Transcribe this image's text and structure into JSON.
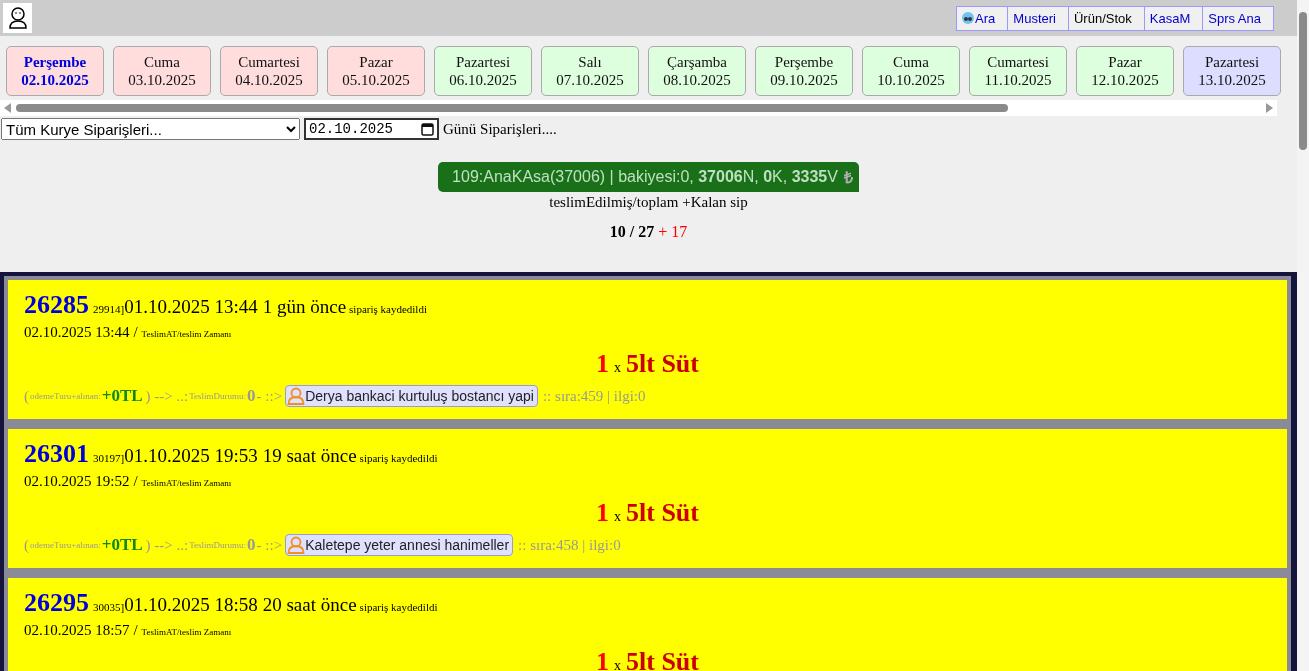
{
  "nav_links": [
    {
      "label": "Ara",
      "color": "#0000cc",
      "icon": true
    },
    {
      "label": "Musteri",
      "color": "#0000cc"
    },
    {
      "label": "Ürün/Stok",
      "color": "#000000"
    },
    {
      "label": "KasaM",
      "color": "#0000cc"
    },
    {
      "label": "Sprs Ana",
      "color": "#0000cc"
    }
  ],
  "days": [
    {
      "day": "Perşembe",
      "date": "02.10.2025",
      "selected": true,
      "color": "#ffdddd"
    },
    {
      "day": "Cuma",
      "date": "03.10.2025",
      "selected": false,
      "color": "#ffdddd"
    },
    {
      "day": "Cumartesi",
      "date": "04.10.2025",
      "selected": false,
      "color": "#ffdddd"
    },
    {
      "day": "Pazar",
      "date": "05.10.2025",
      "selected": false,
      "color": "#ffdddd"
    },
    {
      "day": "Pazartesi",
      "date": "06.10.2025",
      "selected": false,
      "color": "#ddffdd"
    },
    {
      "day": "Salı",
      "date": "07.10.2025",
      "selected": false,
      "color": "#ddffdd"
    },
    {
      "day": "Çarşamba",
      "date": "08.10.2025",
      "selected": false,
      "color": "#ddffdd"
    },
    {
      "day": "Perşembe",
      "date": "09.10.2025",
      "selected": false,
      "color": "#ddffdd"
    },
    {
      "day": "Cuma",
      "date": "10.10.2025",
      "selected": false,
      "color": "#ddffdd"
    },
    {
      "day": "Cumartesi",
      "date": "11.10.2025",
      "selected": false,
      "color": "#ddffdd"
    },
    {
      "day": "Pazar",
      "date": "12.10.2025",
      "selected": false,
      "color": "#ddffdd"
    },
    {
      "day": "Pazartesi",
      "date": "13.10.2025",
      "selected": false,
      "color": "#ddddff"
    }
  ],
  "filter": {
    "courier_select": "Tüm Kurye Siparişleri...",
    "date_value": "02.10.2025",
    "label": "Günü Siparişleri...."
  },
  "summary": {
    "banner": "109:AnaKAsa(37006) | bakiyesi:0, **37006**N, **0**K, **3335**V",
    "currency": "₺",
    "caption": "teslimEdilmiş/toplam +Kalan sip",
    "delivered_total": "10 / 27",
    "remaining": "+ 17"
  },
  "orders": [
    {
      "id": "26285",
      "ref": "29914]",
      "created": "01.10.2025 13:44",
      "ago": "1 gün önce",
      "note": "sipariş kaydedildi",
      "delivery": "02.10.2025 13:44",
      "delivery_sep": "/",
      "delivery_label": "TeslimAT/teslim Zamanı",
      "qty": "1",
      "times": "x",
      "product": "5lt Süt",
      "payment": {
        "open": "(",
        "label": "odemeTuru+alınan:",
        "amount": "+0TL",
        "arrow": ") --> ..:",
        "status_label": "TeslimDurumu:",
        "status": "0",
        "sep": "- ::>",
        "customer": "Derya bankaci kurtuluş bostancı yapi",
        "queue": ":: sıra:459 | ilgi:0"
      }
    },
    {
      "id": "26301",
      "ref": "30197]",
      "created": "01.10.2025 19:53",
      "ago": "19 saat önce",
      "note": "sipariş kaydedildi",
      "delivery": "02.10.2025 19:52",
      "delivery_sep": "/",
      "delivery_label": "TeslimAT/teslim Zamanı",
      "qty": "1",
      "times": "x",
      "product": "5lt Süt",
      "payment": {
        "open": "(",
        "label": "odemeTuru+alınan:",
        "amount": "+0TL",
        "arrow": ") --> ..:",
        "status_label": "TeslimDurumu:",
        "status": "0",
        "sep": "- ::>",
        "customer": "Kaletepe yeter annesi hanimeller",
        "queue": ":: sıra:458 | ilgi:0"
      }
    },
    {
      "id": "26295",
      "ref": "30035]",
      "created": "01.10.2025 18:58",
      "ago": "20 saat önce",
      "note": "sipariş kaydedildi",
      "delivery": "02.10.2025 18:57",
      "delivery_sep": "/",
      "delivery_label": "TeslimAT/teslim Zamanı",
      "qty": "1",
      "times": "x",
      "product": "5lt Süt"
    }
  ]
}
